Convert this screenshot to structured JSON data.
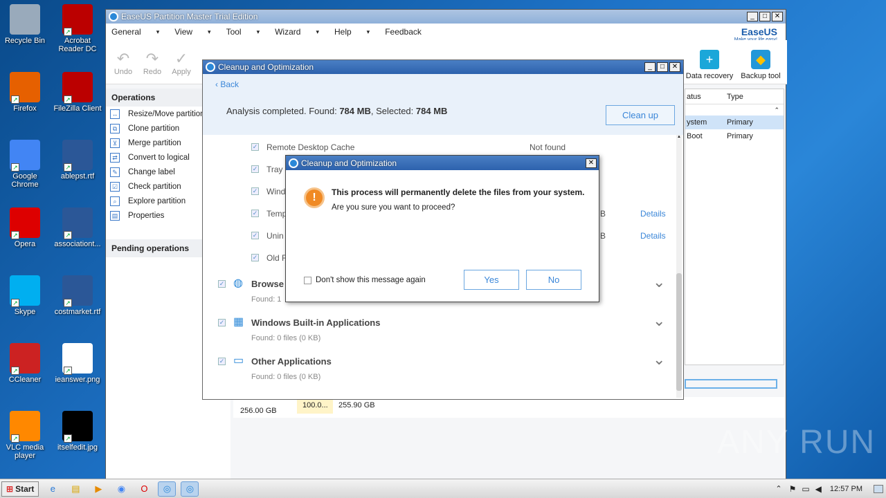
{
  "desktop": {
    "icons": [
      {
        "label": "Recycle Bin",
        "color": "#9ab"
      },
      {
        "label": "Acrobat Reader DC",
        "color": "#b00"
      },
      {
        "label": "Firefox",
        "color": "#e66000"
      },
      {
        "label": "FileZilla Client",
        "color": "#b00"
      },
      {
        "label": "Google Chrome",
        "color": "#4285f4"
      },
      {
        "label": "ablepst.rtf",
        "color": "#2b5797"
      },
      {
        "label": "Opera",
        "color": "#d00"
      },
      {
        "label": "associationt...",
        "color": "#2b5797"
      },
      {
        "label": "Skype",
        "color": "#00aff0"
      },
      {
        "label": "costmarket.rtf",
        "color": "#2b5797"
      },
      {
        "label": "CCleaner",
        "color": "#c22"
      },
      {
        "label": "ieanswer.png",
        "color": "#fff"
      },
      {
        "label": "VLC media player",
        "color": "#f80"
      },
      {
        "label": "itselfedit.jpg",
        "color": "#000"
      }
    ]
  },
  "main": {
    "title": "EaseUS Partition Master Trial Edition",
    "menu": [
      "General",
      "View",
      "Tool",
      "Wizard",
      "Help",
      "Feedback"
    ],
    "logo": "EaseUS",
    "tagline": "Make your life easy!",
    "toolbar": [
      "Undo",
      "Redo",
      "Apply"
    ],
    "right_tools": [
      "Data recovery",
      "Backup tool"
    ],
    "ops_header": "Operations",
    "ops": [
      "Resize/Move partition",
      "Clone partition",
      "Merge partition",
      "Convert to logical",
      "Change label",
      "Check partition",
      "Explore partition",
      "Properties"
    ],
    "pending": "Pending operations",
    "table_headers": [
      "atus",
      "Type"
    ],
    "rows": [
      [
        "ystem",
        "Primary"
      ],
      [
        "Boot",
        "Primary"
      ]
    ],
    "disk": {
      "size": "256.00 GB",
      "part1": "100.0...",
      "part2": "255.90 GB"
    }
  },
  "cleanup": {
    "title": "Cleanup and Optimization",
    "back": "Back",
    "summary_prefix": "Analysis completed. Found: ",
    "found": "784 MB",
    "selected_prefix": ", Selected: ",
    "selected": "784 MB",
    "clean_btn": "Clean up",
    "items": [
      {
        "label": "Remote Desktop Cache",
        "status": "Not found",
        "details": ""
      },
      {
        "label": "Tray",
        "status": "",
        "details": ""
      },
      {
        "label": "Wind",
        "status": "",
        "details": ""
      },
      {
        "label": "Temp",
        "status": "B",
        "details": "Details"
      },
      {
        "label": "Unin",
        "status": "B",
        "details": "Details"
      },
      {
        "label": "Old F",
        "status": "",
        "details": ""
      }
    ],
    "groups": [
      {
        "title": "Browse",
        "sub": "Found: 1"
      },
      {
        "title": "Windows Built-in Applications",
        "sub": "Found: 0 files (0 KB)"
      },
      {
        "title": "Other Applications",
        "sub": "Found: 0 files (0 KB)"
      }
    ]
  },
  "dialog": {
    "title": "Cleanup and Optimization",
    "msg1": "This process will permanently delete the files from your system.",
    "msg2": "Are you sure you want to proceed?",
    "checkbox": "Don't show this message again",
    "yes": "Yes",
    "no": "No"
  },
  "taskbar": {
    "start": "Start",
    "time": "12:57 PM"
  },
  "watermark": "ANY RUN"
}
